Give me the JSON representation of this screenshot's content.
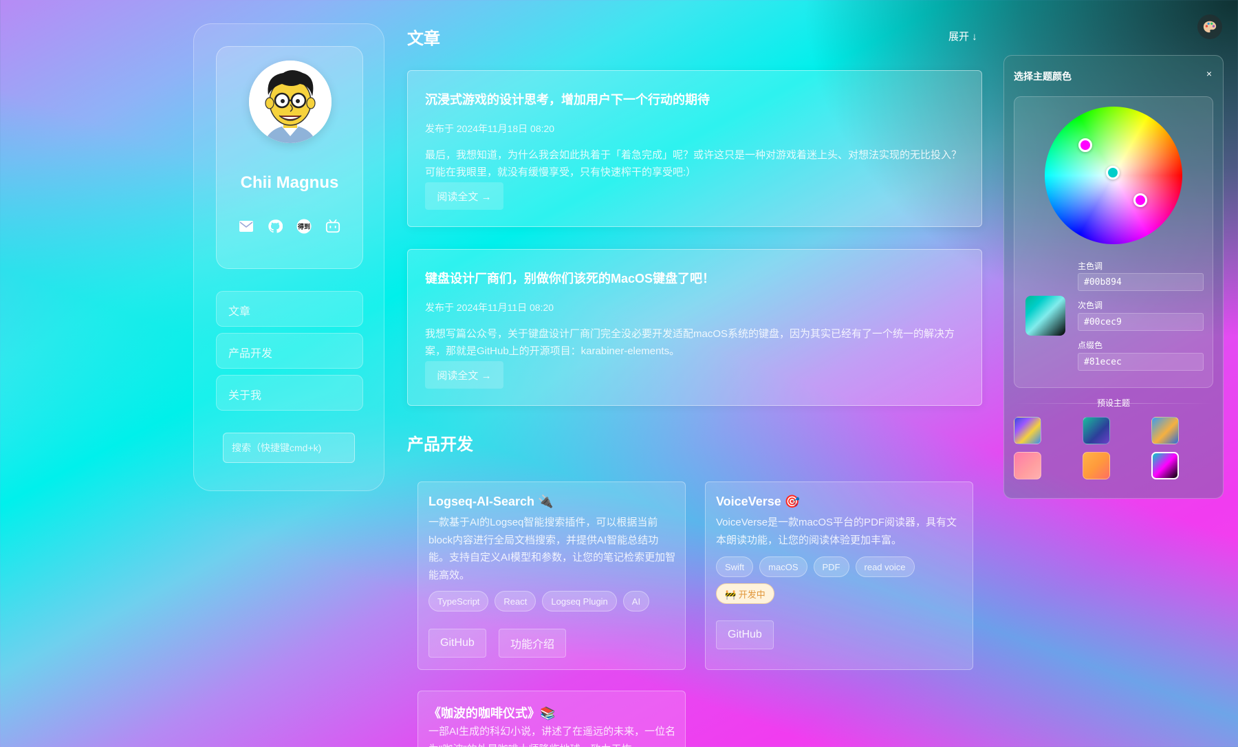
{
  "profile": {
    "name": "Chii Magnus",
    "social_icons": [
      "mail-icon",
      "github-icon",
      "dedao-icon",
      "bilibili-icon"
    ],
    "badge_text": "得到"
  },
  "nav": {
    "items": [
      {
        "label": "文章"
      },
      {
        "label": "产品开发"
      },
      {
        "label": "关于我"
      }
    ]
  },
  "search": {
    "placeholder": "搜索（快捷键cmd+k)"
  },
  "articles_section": {
    "title": "文章",
    "expand_label": "展开 ↓",
    "items": [
      {
        "title": "沉浸式游戏的设计思考，增加用户下一个行动的期待",
        "date": "发布于 2024年11月18日 08:20",
        "excerpt": "最后，我想知道，为什么我会如此执着于「着急完成」呢？或许这只是一种对游戏着迷上头、对想法实现的无比投入？ 可能在我眼里，就没有缓慢享受，只有快速榨干的享受吧:）",
        "read_more": "阅读全文 →"
      },
      {
        "title": "键盘设计厂商们，别做你们该死的MacOS键盘了吧！",
        "date": "发布于 2024年11月11日 08:20",
        "excerpt": "我想写篇公众号，关于键盘设计厂商门完全没必要开发适配macOS系统的键盘，因为其实已经有了一个统一的解决方案，那就是GitHub上的开源项目：karabiner-elements。",
        "read_more": "阅读全文 →"
      }
    ]
  },
  "products_section": {
    "title": "产品开发",
    "items": [
      {
        "title": "Logseq-AI-Search 🔌",
        "description": "一款基于AI的Logseq智能搜索插件，可以根据当前block内容进行全局文档搜索，并提供AI智能总结功能。支持自定义AI模型和参数，让您的笔记检索更加智能高效。",
        "tags": [
          "TypeScript",
          "React",
          "Logseq Plugin",
          "AI"
        ],
        "buttons": [
          "GitHub",
          "功能介绍"
        ]
      },
      {
        "title": "VoiceVerse 🎯",
        "description": "VoiceVerse是一款macOS平台的PDF阅读器，具有文本朗读功能，让您的阅读体验更加丰富。",
        "tags": [
          "Swift",
          "macOS",
          "PDF",
          "read voice"
        ],
        "status_tag": "🚧 开发中",
        "buttons": [
          "GitHub"
        ]
      },
      {
        "title": "《咖波的咖啡仪式》📚",
        "description": "一部AI生成的科幻小说，讲述了在遥远的未来，一位名为\"咖波\"的外星咖啡大师降临地球，致力于恢"
      }
    ]
  },
  "theme_panel": {
    "title": "选择主题颜色",
    "close_label": "×",
    "primary_label": "主色调",
    "primary_value": "#00b894",
    "secondary_label": "次色调",
    "secondary_value": "#00cec9",
    "accent_label": "点缀色",
    "accent_value": "#81ecec",
    "presets_label": "预设主题",
    "knob_colors": [
      "#ff00ff",
      "#00cec9",
      "#ff00ff"
    ],
    "presets": [
      "preset-rainbow",
      "preset-teal-purple",
      "preset-sunset-blue",
      "preset-pink",
      "preset-orange",
      "preset-neon-dark"
    ]
  },
  "colors": {
    "accent_primary": "#00b894",
    "accent_secondary": "#00cec9",
    "accent_tertiary": "#81ecec",
    "dev_tag_bg": "#fff3dc",
    "dev_tag_text": "#e0963a"
  }
}
